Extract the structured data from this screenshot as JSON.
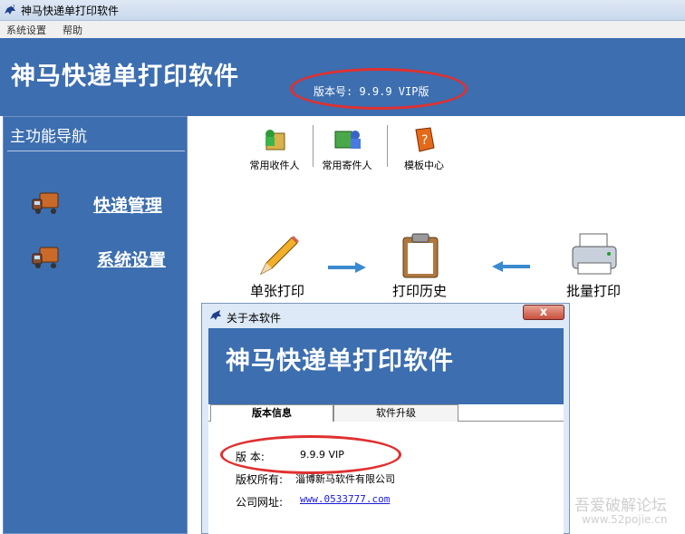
{
  "window": {
    "title": "神马快递单打印软件"
  },
  "menubar": {
    "items": [
      "系统设置",
      "帮助"
    ]
  },
  "header": {
    "app_name": "神马快递单打印软件",
    "version_label": "版本号: 9.9.9  VIP版"
  },
  "sidebar": {
    "title": "主功能导航",
    "items": [
      {
        "label": "快递管理",
        "icon": "truck-icon"
      },
      {
        "label": "系统设置",
        "icon": "truck-icon"
      }
    ]
  },
  "toolbar": {
    "items": [
      {
        "label": "常用收件人",
        "icon": "recipient-icon"
      },
      {
        "label": "常用寄件人",
        "icon": "sender-icon"
      },
      {
        "label": "模板中心",
        "icon": "template-book-icon"
      }
    ]
  },
  "workflow": {
    "single_print": "单张打印",
    "print_history": "打印历史",
    "batch_print": "批量打印"
  },
  "about_dialog": {
    "title": "关于本软件",
    "close_label": "x",
    "app_name": "神马快递单打印软件",
    "tabs": [
      "版本信息",
      "软件升级"
    ],
    "version_label": "版  本:",
    "version_value": "9.9.9  VIP",
    "copyright_label": "版权所有:",
    "copyright_value": "淄博新马软件有限公司",
    "website_label": "公司网址:",
    "website_value": "www.0533777.com"
  },
  "watermark": {
    "line1": "吾爱破解论坛",
    "line2": "www.52pojie.cn"
  },
  "colors": {
    "header_blue": "#3c6eb0",
    "highlight_red": "#e03030",
    "link_blue": "#1a1ad8"
  }
}
